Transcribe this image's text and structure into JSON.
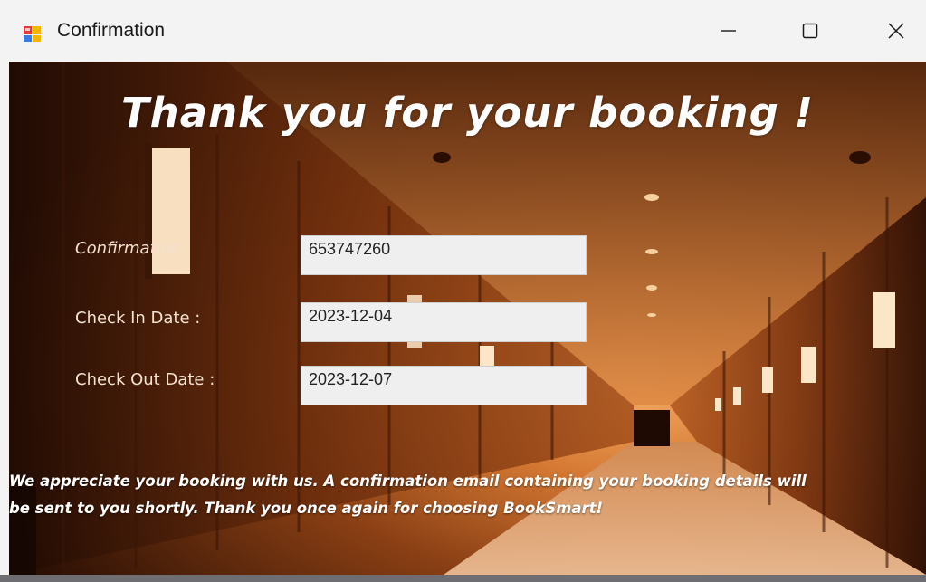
{
  "window": {
    "title": "Confirmation"
  },
  "controls": {
    "minimize": "minimize-icon",
    "maximize": "maximize-icon",
    "close": "close-icon"
  },
  "content": {
    "heading": "Thank you for your booking !",
    "fields": [
      {
        "label": "Confirmation",
        "value": "653747260"
      },
      {
        "label": "Check In Date :",
        "value": "2023-12-04"
      },
      {
        "label": "Check Out Date :",
        "value": "2023-12-07"
      }
    ],
    "message_line1": "We appreciate your booking with us. A confirmation email containing your booking details will",
    "message_line2": "be sent to you shortly. Thank you once again for choosing BookSmart!"
  },
  "colors": {
    "title_bar": "#f3f3f3",
    "text_white": "#ffffff",
    "field_bg": "#efefef",
    "background_warm": "#c4672a"
  }
}
